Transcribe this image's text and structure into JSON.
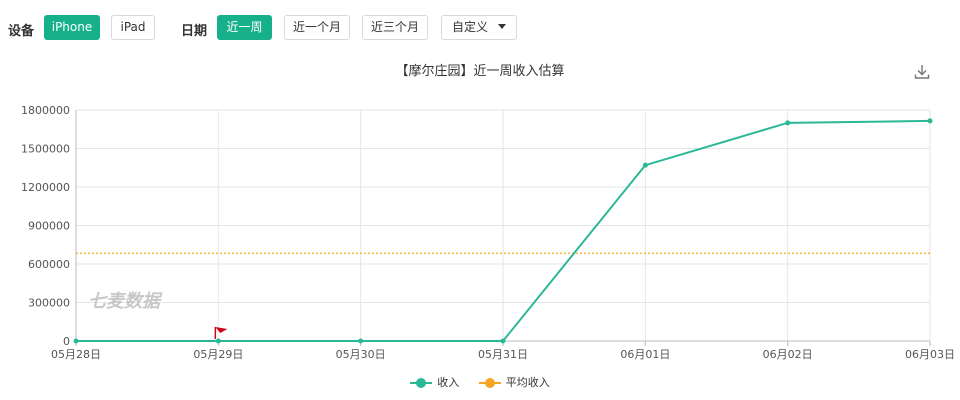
{
  "filters": {
    "device_label": "设备",
    "device_options": [
      "iPhone",
      "iPad"
    ],
    "date_label": "日期",
    "date_options": [
      "近一周",
      "近一个月",
      "近三个月"
    ],
    "custom_label": "自定义"
  },
  "chart_title": "【摩尔庄园】近一周收入估算",
  "watermark": "七麦数据",
  "colors": {
    "accent": "#16b08b",
    "income": "#2bb897",
    "average": "#f5a623",
    "marker": "#d0021b"
  },
  "icons": {
    "download": "download-icon"
  },
  "chart_data": {
    "type": "line",
    "title": "【摩尔庄园】近一周收入估算",
    "xlabel": "",
    "ylabel": "",
    "x": [
      "05月28日",
      "05月29日",
      "05月30日",
      "05月31日",
      "06月01日",
      "06月02日",
      "06月03日"
    ],
    "ylim": [
      0,
      1800000
    ],
    "yticks": [
      0,
      300000,
      600000,
      900000,
      1200000,
      1500000,
      1800000
    ],
    "grid": true,
    "legend": "bottom-center",
    "series": [
      {
        "name": "收入",
        "values": [
          0,
          0,
          0,
          0,
          1370000,
          1700000,
          1715000
        ]
      },
      {
        "name": "平均收入",
        "values": [
          684000,
          684000,
          684000,
          684000,
          684000,
          684000,
          684000
        ]
      }
    ],
    "annotations": [
      {
        "type": "flag",
        "x": "05月29日",
        "y": 0
      }
    ]
  }
}
